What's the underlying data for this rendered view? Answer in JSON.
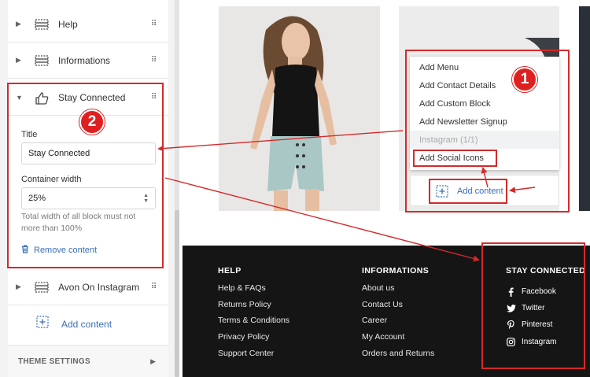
{
  "sidebar": {
    "items": [
      {
        "label": "Help"
      },
      {
        "label": "Informations"
      },
      {
        "label": "Stay Connected"
      },
      {
        "label": "Avon On Instagram"
      }
    ],
    "panel": {
      "title_label": "Title",
      "title_value": "Stay Connected",
      "width_label": "Container width",
      "width_value": "25%",
      "hint": "Total width of all block must not more than 100%",
      "remove_label": "Remove content"
    },
    "add_content": "Add content",
    "theme_settings": "THEME SETTINGS"
  },
  "dropdown": {
    "items": [
      {
        "label": "Add Menu"
      },
      {
        "label": "Add Contact Details"
      },
      {
        "label": "Add Custom Block"
      },
      {
        "label": "Add Newsletter Signup"
      },
      {
        "label": "Instagram (1/1)",
        "disabled": true
      },
      {
        "label": "Add Social Icons"
      }
    ]
  },
  "preview": {
    "add_content": "Add content"
  },
  "footer": {
    "help": {
      "heading": "HELP",
      "links": [
        "Help & FAQs",
        "Returns Policy",
        "Terms & Conditions",
        "Privacy Policy",
        "Support Center"
      ]
    },
    "informations": {
      "heading": "INFORMATIONS",
      "links": [
        "About us",
        "Contact Us",
        "Career",
        "My Account",
        "Orders and Returns"
      ]
    },
    "stay_connected": {
      "heading": "STAY CONNECTED",
      "social": [
        {
          "label": "Facebook",
          "icon": "facebook-icon"
        },
        {
          "label": "Twitter",
          "icon": "twitter-icon"
        },
        {
          "label": "Pinterest",
          "icon": "pinterest-icon"
        },
        {
          "label": "Instagram",
          "icon": "instagram-icon"
        }
      ]
    }
  },
  "annotations": {
    "badge_1": "1",
    "badge_2": "2"
  },
  "colors": {
    "annotation_red": "#d42a2a",
    "link_blue": "#3a6fb8",
    "footer_bg": "#151515"
  }
}
